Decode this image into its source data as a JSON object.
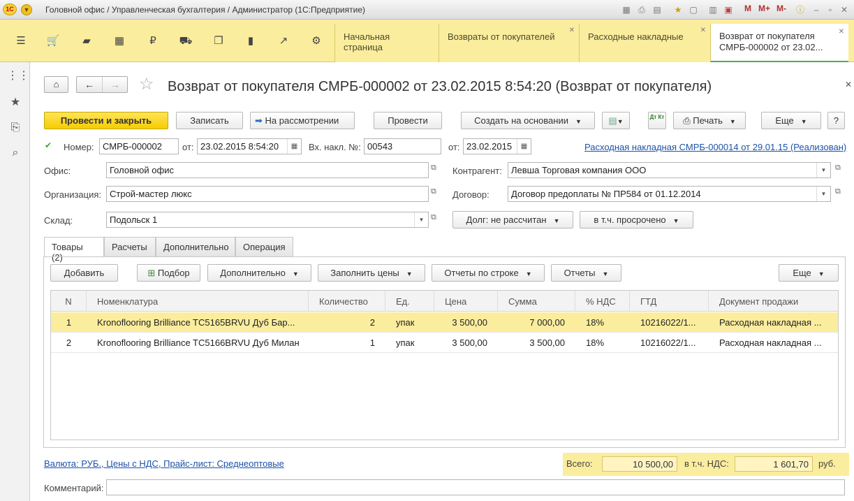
{
  "titlebar": {
    "logo": "1С",
    "title": "Головной офис / Управленческая бухгалтерия / Администратор  (1С:Предприятие)",
    "marks": [
      "M",
      "M+",
      "M-"
    ]
  },
  "sections_icons": [
    "menu-icon",
    "cart-icon",
    "bag-icon",
    "grid-icon",
    "ruble-icon",
    "truck-icon",
    "copy-icon",
    "bar-chart-icon",
    "trend-icon",
    "gear-icon"
  ],
  "tabs": [
    {
      "label": "Начальная страница"
    },
    {
      "label": "Возвраты от покупателей"
    },
    {
      "label": "Расходные накладные"
    },
    {
      "label": "Возврат от покупателя",
      "label2": "СМРБ-000002 от 23.02..."
    }
  ],
  "form": {
    "title": "Возврат от покупателя СМРБ-000002 от 23.02.2015 8:54:20 (Возврат от покупателя)",
    "toolbar": {
      "post_close": "Провести и закрыть",
      "save": "Записать",
      "review": "На рассмотрении",
      "post": "Провести",
      "create_based": "Создать на основании",
      "print": "Печать",
      "more": "Еще",
      "help": "?",
      "dtkt": "Дт Кт"
    },
    "number_label": "Номер:",
    "number": "СМРБ-000002",
    "date_label": "от:",
    "date": "23.02.2015  8:54:20",
    "inv_label": "Вх. накл. №:",
    "inv_number": "00543",
    "inv_date_label": "от:",
    "inv_date": "23.02.2015",
    "base_doc_link": "Расходная накладная СМРБ-000014 от 29.01.15 (Реализован)",
    "office_label": "Офис:",
    "office": "Головной офис",
    "org_label": "Организация:",
    "org": "Строй-мастер люкс",
    "warehouse_label": "Склад:",
    "warehouse": "Подольск 1",
    "counterparty_label": "Контрагент:",
    "counterparty": "Левша Торговая компания ООО",
    "contract_label": "Договор:",
    "contract": "Договор предоплаты № ПР584 от 01.12.2014",
    "debt_btn": "Долг: не рассчитан",
    "overdue_btn": "в т.ч. просрочено"
  },
  "subtabs": [
    "Товары (2)",
    "Расчеты",
    "Дополнительно",
    "Операция"
  ],
  "table_toolbar": {
    "add": "Добавить",
    "pick": "Подбор",
    "extra": "Дополнительно",
    "fill_prices": "Заполнить цены",
    "row_reports": "Отчеты по строке",
    "reports": "Отчеты",
    "more": "Еще"
  },
  "table": {
    "columns": [
      "N",
      "Номенклатура",
      "Количество",
      "Ед.",
      "Цена",
      "Сумма",
      "% НДС",
      "ГТД",
      "Документ продажи"
    ],
    "rows": [
      {
        "n": "1",
        "item": "Kronoflooring Brilliance TC5165BRVU Дуб Бар...",
        "qty": "2",
        "unit": "упак",
        "price": "3 500,00",
        "sum": "7 000,00",
        "vat": "18%",
        "gtd": "10216022/1...",
        "doc": "Расходная накладная ..."
      },
      {
        "n": "2",
        "item": "Kronoflooring Brilliance TC5166BRVU Дуб Милан",
        "qty": "1",
        "unit": "упак",
        "price": "3 500,00",
        "sum": "3 500,00",
        "vat": "18%",
        "gtd": "10216022/1...",
        "doc": "Расходная накладная ..."
      }
    ]
  },
  "footer": {
    "currency_link": "Валюта: РУБ., Цены с НДС, Прайс-лист: Среднеоптовые",
    "total_label": "Всего:",
    "total": "10 500,00",
    "vat_label": "в т.ч. НДС:",
    "vat": "1 601,70",
    "currency": "руб.",
    "comment_label": "Комментарий:",
    "comment": ""
  },
  "colors": {
    "accent": "#fbed9e",
    "primary_button": "#f5cd00",
    "link": "#1c52a8",
    "active_tab_underline": "#4fae4f"
  }
}
